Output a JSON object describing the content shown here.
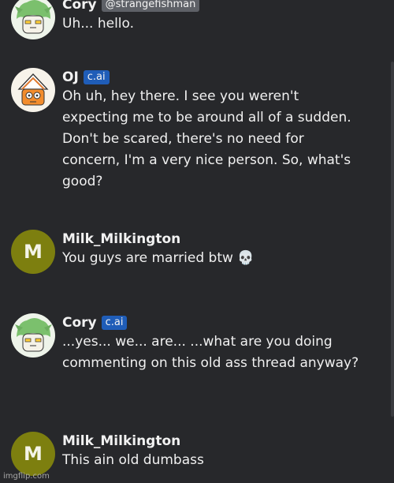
{
  "messages": [
    {
      "author": "Cory",
      "tag": "@strangefishman",
      "text": "Uh... hello.",
      "avatar_icon": "green-haired-character-avatar-icon"
    },
    {
      "author": "OJ",
      "tag": "c.ai",
      "text": "Oh uh, hey there. I see you weren't expecting me to be around all of a sudden. Don't be scared, there's no need for concern, I'm a very nice person. So, what's good?",
      "avatar_icon": "orange-character-avatar-icon"
    },
    {
      "author": "Milk_Milkington",
      "avatar_letter": "M",
      "text": "You guys are married btw 💀"
    },
    {
      "author": "Cory",
      "tag": "c.ai",
      "text": "...yes... we... are... ...what are you doing commenting on this old ass thread anyway?",
      "avatar_icon": "green-haired-character-avatar-icon"
    },
    {
      "author": "Milk_Milkington",
      "avatar_letter": "M",
      "text": "This ain old dumbass"
    }
  ],
  "watermark": "imgflip.com",
  "colors": {
    "background": "#27282b",
    "handle_badge": "#5e6167",
    "cai_badge": "#1f5db8",
    "letter_avatar": "#7d7f0f"
  }
}
